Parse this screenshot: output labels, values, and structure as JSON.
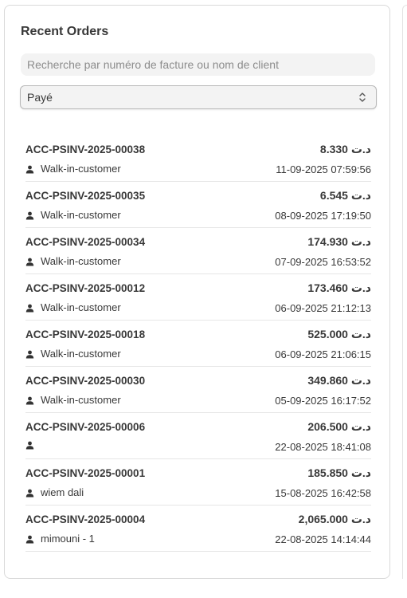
{
  "panel": {
    "title": "Recent Orders",
    "search": {
      "placeholder": "Recherche par numéro de facture ou nom de client",
      "value": ""
    },
    "status_filter": {
      "selected": "Payé"
    }
  },
  "orders": [
    {
      "invoice": "ACC-PSINV-2025-00038",
      "amount": "د.ت 8.330",
      "customer": "Walk-in-customer",
      "datetime": "11-09-2025 07:59:56"
    },
    {
      "invoice": "ACC-PSINV-2025-00035",
      "amount": "د.ت 6.545",
      "customer": "Walk-in-customer",
      "datetime": "08-09-2025 17:19:50"
    },
    {
      "invoice": "ACC-PSINV-2025-00034",
      "amount": "د.ت 174.930",
      "customer": "Walk-in-customer",
      "datetime": "07-09-2025 16:53:52"
    },
    {
      "invoice": "ACC-PSINV-2025-00012",
      "amount": "د.ت 173.460",
      "customer": "Walk-in-customer",
      "datetime": "06-09-2025 21:12:13"
    },
    {
      "invoice": "ACC-PSINV-2025-00018",
      "amount": "د.ت 525.000",
      "customer": "Walk-in-customer",
      "datetime": "06-09-2025 21:06:15"
    },
    {
      "invoice": "ACC-PSINV-2025-00030",
      "amount": "د.ت 349.860",
      "customer": "Walk-in-customer",
      "datetime": "05-09-2025 16:17:52"
    },
    {
      "invoice": "ACC-PSINV-2025-00006",
      "amount": "د.ت 206.500",
      "customer": "",
      "datetime": "22-08-2025 18:41:08"
    },
    {
      "invoice": "ACC-PSINV-2025-00001",
      "amount": "د.ت 185.850",
      "customer": "wiem dali",
      "datetime": "15-08-2025 16:42:58"
    },
    {
      "invoice": "ACC-PSINV-2025-00004",
      "amount": "د.ت 2,065.000",
      "customer": "mimouni - 1",
      "datetime": "22-08-2025 14:14:44"
    }
  ]
}
